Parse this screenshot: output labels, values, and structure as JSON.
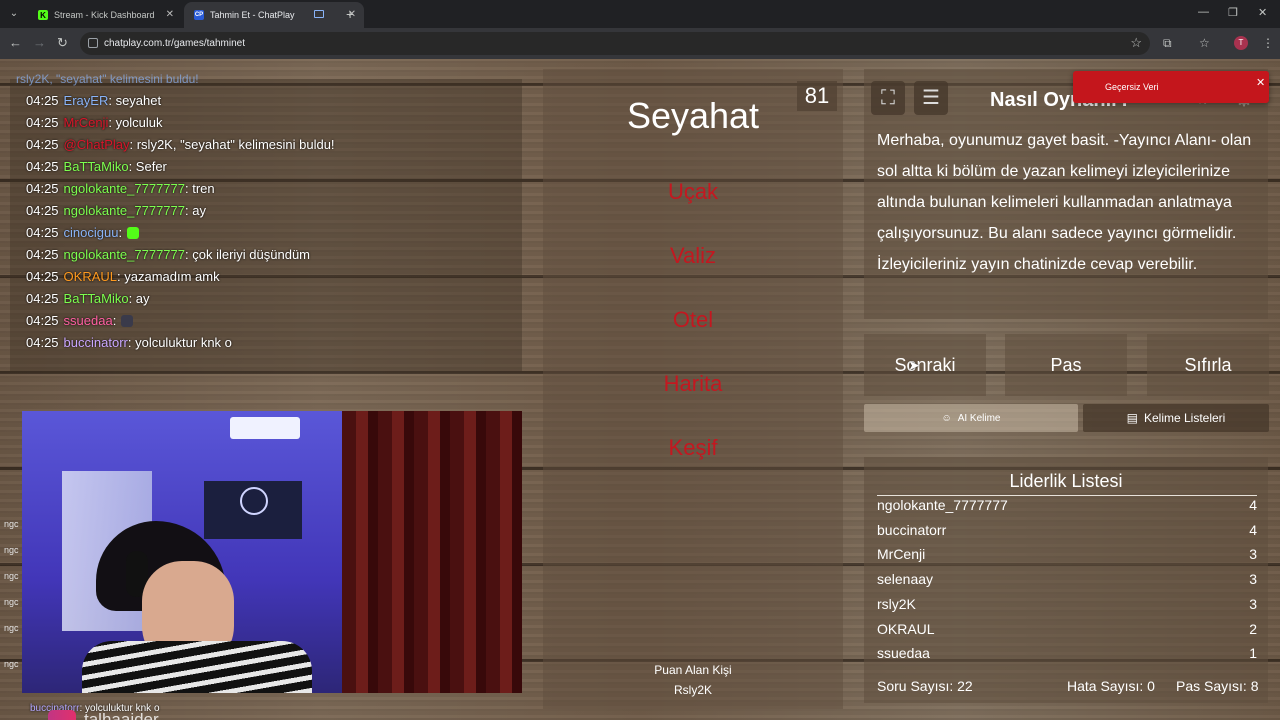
{
  "browser": {
    "tabs": [
      {
        "label": "Stream - Kick Dashboard",
        "favicon": "K"
      },
      {
        "label": "Tahmin Et - ChatPlay",
        "favicon": "CP"
      }
    ],
    "url": "chatplay.com.tr/games/tahminet",
    "profile_initial": "T"
  },
  "chat": {
    "top_partial": "rsly2K, \"seyahat\" kelimesini buldu!",
    "messages": [
      {
        "time": "04:25",
        "user": "ErayER",
        "color": "#8ab4f8",
        "text": ": seyahet"
      },
      {
        "time": "04:25",
        "user": "MrCenji",
        "color": "#d8152a",
        "text": ": yolculuk"
      },
      {
        "time": "04:25",
        "user": "@ChatPlay",
        "color": "#d8152a",
        "text": ": rsly2K, \"seyahat\" kelimesini buldu!"
      },
      {
        "time": "04:25",
        "user": "BaTTaMiko",
        "color": "#7dff4f",
        "text": ": Sefer"
      },
      {
        "time": "04:25",
        "user": "ngolokante_7777777",
        "color": "#7dff4f",
        "text": ": tren"
      },
      {
        "time": "04:25",
        "user": "ngolokante_7777777",
        "color": "#7dff4f",
        "text": ": ay"
      },
      {
        "time": "04:25",
        "user": "cinociguu",
        "color": "#8ab4f8",
        "text": ":"
      },
      {
        "time": "04:25",
        "user": "ngolokante_7777777",
        "color": "#7dff4f",
        "text": ": çok ileriyi düşündüm"
      },
      {
        "time": "04:25",
        "user": "OKRAUL",
        "color": "#ff9a1f",
        "text": ": yazamadım amk"
      },
      {
        "time": "04:25",
        "user": "BaTTaMiko",
        "color": "#7dff4f",
        "text": ": ay"
      },
      {
        "time": "04:25",
        "user": "ssuedaa",
        "color": "#ff5fa2",
        "text": ":"
      },
      {
        "time": "04:25",
        "user": "buccinatorr",
        "color": "#c9a6ff",
        "text": ": yolculuktur knk o"
      }
    ],
    "bottom_user": "buccinatorr",
    "bottom_text": ": yolculuktur knk o",
    "bottom_handle": "talhaaider"
  },
  "game": {
    "timer": "81",
    "word": "Seyahat",
    "forbidden_words": [
      "Uçak",
      "Valiz",
      "Otel",
      "Harita",
      "Keşif"
    ],
    "scorer_label": "Puan Alan Kişi",
    "scorer_name": "Rsly2K"
  },
  "howto": {
    "title": "Nasıl Oynanır?",
    "text": "Merhaba, oyunumuz gayet basit. -Yayıncı Alanı- olan sol altta ki bölüm de yazan kelimeyi izleyicilerinize altında bulunan kelimeleri kullanmadan anlatmaya çalışıyorsunuz. Bu alanı sadece yayıncı görmelidir. İzleyicileriniz yayın chatinizde cevap verebilir.",
    "toast": "Geçersiz Veri"
  },
  "actions": {
    "next": "Sonraki",
    "pass": "Pas",
    "reset": "Sıfırla",
    "ai_word": "AI Kelime",
    "word_lists": "Kelime Listeleri"
  },
  "leaderboard": {
    "title": "Liderlik Listesi",
    "rows": [
      {
        "name": "ngolokante_7777777",
        "score": "4"
      },
      {
        "name": "buccinatorr",
        "score": "4"
      },
      {
        "name": "MrCenji",
        "score": "3"
      },
      {
        "name": "selenaay",
        "score": "3"
      },
      {
        "name": "rsly2K",
        "score": "3"
      },
      {
        "name": "OKRAUL",
        "score": "2"
      },
      {
        "name": "ssuedaa",
        "score": "1"
      }
    ],
    "question_count": "Soru Sayısı: 22",
    "error_count": "Hata Sayısı: 0",
    "pass_count": "Pas Sayısı: 8"
  }
}
